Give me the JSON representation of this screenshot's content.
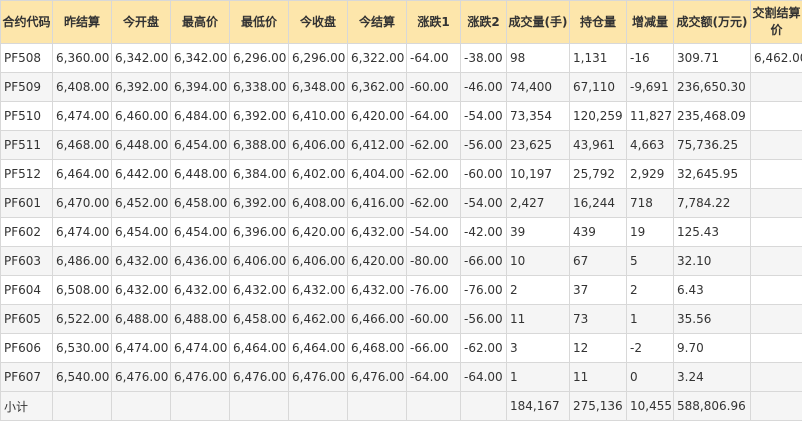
{
  "headers": [
    "合约代码",
    "昨结算",
    "今开盘",
    "最高价",
    "最低价",
    "今收盘",
    "今结算",
    "涨跌1",
    "涨跌2",
    "成交量(手)",
    "持仓量",
    "增减量",
    "成交额(万元)",
    "交割结算价"
  ],
  "rows": [
    [
      "PF508",
      "6,360.00",
      "6,342.00",
      "6,342.00",
      "6,296.00",
      "6,296.00",
      "6,322.00",
      "-64.00",
      "-38.00",
      "98",
      "1,131",
      "-16",
      "309.71",
      "6,462.00"
    ],
    [
      "PF509",
      "6,408.00",
      "6,392.00",
      "6,394.00",
      "6,338.00",
      "6,348.00",
      "6,362.00",
      "-60.00",
      "-46.00",
      "74,400",
      "67,110",
      "-9,691",
      "236,650.30",
      ""
    ],
    [
      "PF510",
      "6,474.00",
      "6,460.00",
      "6,484.00",
      "6,392.00",
      "6,410.00",
      "6,420.00",
      "-64.00",
      "-54.00",
      "73,354",
      "120,259",
      "11,827",
      "235,468.09",
      ""
    ],
    [
      "PF511",
      "6,468.00",
      "6,448.00",
      "6,454.00",
      "6,388.00",
      "6,406.00",
      "6,412.00",
      "-62.00",
      "-56.00",
      "23,625",
      "43,961",
      "4,663",
      "75,736.25",
      ""
    ],
    [
      "PF512",
      "6,464.00",
      "6,442.00",
      "6,448.00",
      "6,384.00",
      "6,402.00",
      "6,404.00",
      "-62.00",
      "-60.00",
      "10,197",
      "25,792",
      "2,929",
      "32,645.95",
      ""
    ],
    [
      "PF601",
      "6,470.00",
      "6,452.00",
      "6,458.00",
      "6,392.00",
      "6,408.00",
      "6,416.00",
      "-62.00",
      "-54.00",
      "2,427",
      "16,244",
      "718",
      "7,784.22",
      ""
    ],
    [
      "PF602",
      "6,474.00",
      "6,454.00",
      "6,454.00",
      "6,396.00",
      "6,420.00",
      "6,432.00",
      "-54.00",
      "-42.00",
      "39",
      "439",
      "19",
      "125.43",
      ""
    ],
    [
      "PF603",
      "6,486.00",
      "6,432.00",
      "6,436.00",
      "6,406.00",
      "6,406.00",
      "6,420.00",
      "-80.00",
      "-66.00",
      "10",
      "67",
      "5",
      "32.10",
      ""
    ],
    [
      "PF604",
      "6,508.00",
      "6,432.00",
      "6,432.00",
      "6,432.00",
      "6,432.00",
      "6,432.00",
      "-76.00",
      "-76.00",
      "2",
      "37",
      "2",
      "6.43",
      ""
    ],
    [
      "PF605",
      "6,522.00",
      "6,488.00",
      "6,488.00",
      "6,458.00",
      "6,462.00",
      "6,466.00",
      "-60.00",
      "-56.00",
      "11",
      "73",
      "1",
      "35.56",
      ""
    ],
    [
      "PF606",
      "6,530.00",
      "6,474.00",
      "6,474.00",
      "6,464.00",
      "6,464.00",
      "6,468.00",
      "-66.00",
      "-62.00",
      "3",
      "12",
      "-2",
      "9.70",
      ""
    ],
    [
      "PF607",
      "6,540.00",
      "6,476.00",
      "6,476.00",
      "6,476.00",
      "6,476.00",
      "6,476.00",
      "-64.00",
      "-64.00",
      "1",
      "11",
      "0",
      "3.24",
      ""
    ]
  ],
  "subtotal": [
    "小计",
    "",
    "",
    "",
    "",
    "",
    "",
    "",
    "",
    "184,167",
    "275,136",
    "10,455",
    "588,806.96",
    ""
  ]
}
